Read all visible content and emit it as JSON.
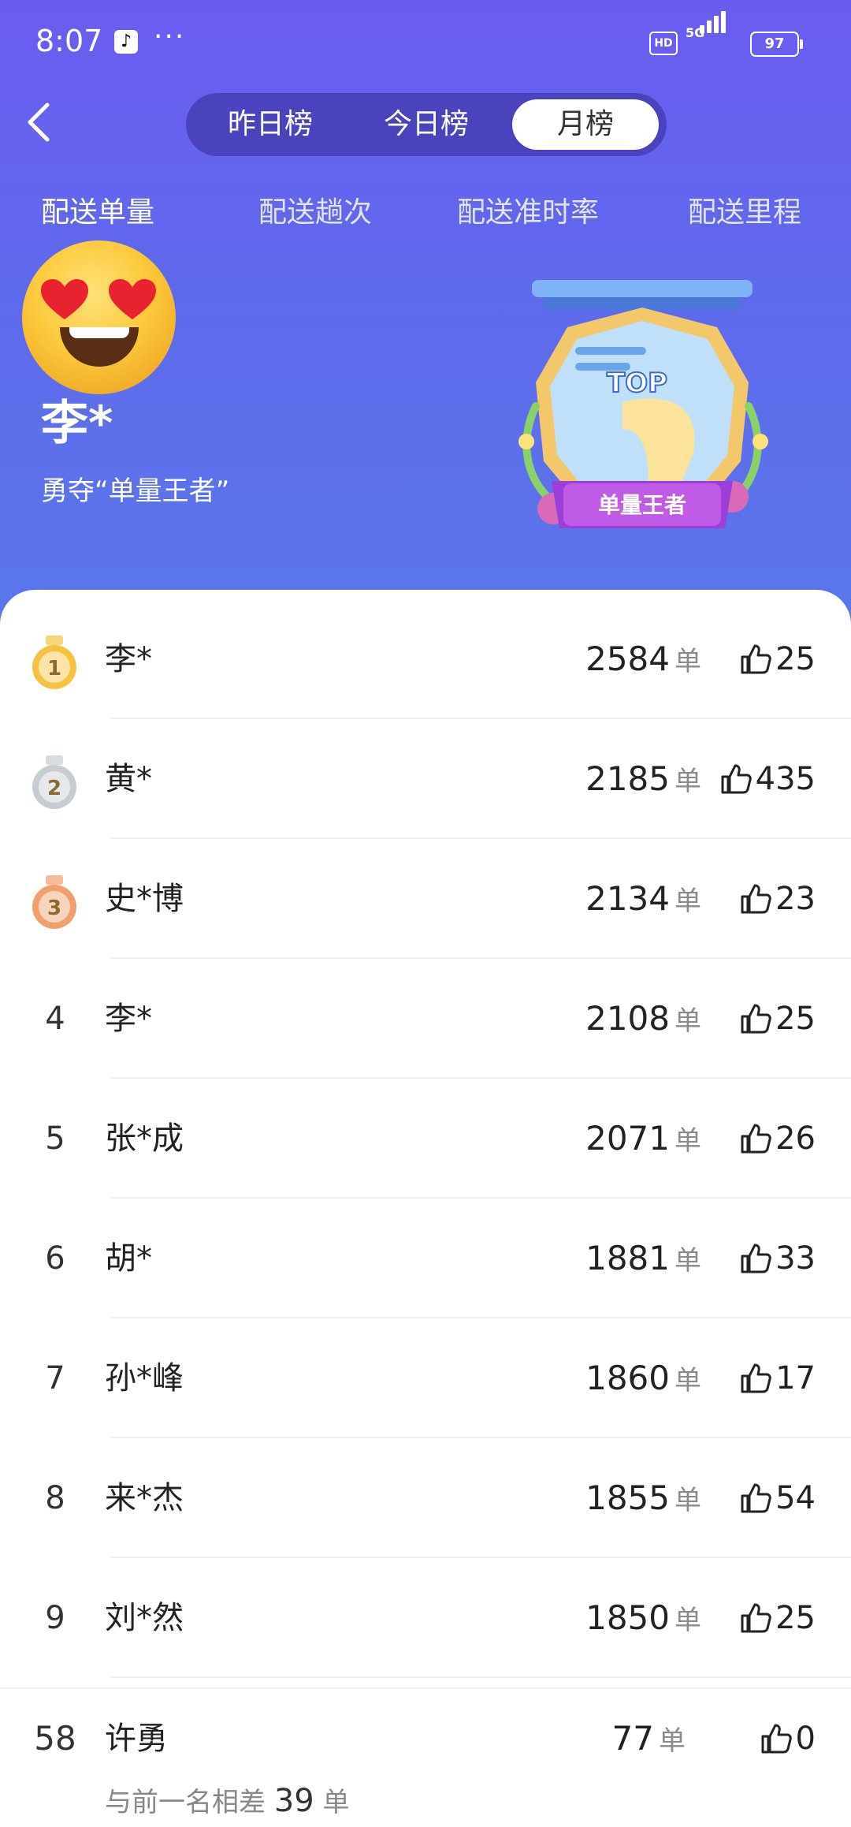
{
  "status_bar": {
    "time": "8:07",
    "tiktok_glyph": "♪",
    "more": "···",
    "hd": "HD",
    "network": "5G",
    "battery": "97"
  },
  "tabs": [
    "昨日榜",
    "今日榜",
    "月榜"
  ],
  "active_tab": "月榜",
  "categories": [
    "配送单量",
    "配送趟次",
    "配送准时率",
    "配送里程"
  ],
  "active_category": "配送单量",
  "leader": {
    "name": "李*",
    "title": "勇夺“单量王者”",
    "badge_top": "TOP",
    "badge_label": "单量王者"
  },
  "unit": "单",
  "ranking": [
    {
      "rank": "1",
      "name": "李*",
      "orders": "2584",
      "likes": "25",
      "medal": "gold"
    },
    {
      "rank": "2",
      "name": "黄*",
      "orders": "2185",
      "likes": "435",
      "medal": "silver"
    },
    {
      "rank": "3",
      "name": "史*博",
      "orders": "2134",
      "likes": "23",
      "medal": "bronze"
    },
    {
      "rank": "4",
      "name": "李*",
      "orders": "2108",
      "likes": "25"
    },
    {
      "rank": "5",
      "name": "张*成",
      "orders": "2071",
      "likes": "26"
    },
    {
      "rank": "6",
      "name": "胡*",
      "orders": "1881",
      "likes": "33"
    },
    {
      "rank": "7",
      "name": "孙*峰",
      "orders": "1860",
      "likes": "17"
    },
    {
      "rank": "8",
      "name": "来*杰",
      "orders": "1855",
      "likes": "54"
    },
    {
      "rank": "9",
      "name": "刘*然",
      "orders": "1850",
      "likes": "25"
    }
  ],
  "my_rank": {
    "rank": "58",
    "name": "许勇",
    "orders": "77",
    "likes": "0",
    "gap_prefix": "与前一名相差",
    "gap_value": "39",
    "gap_unit": "单"
  },
  "colors": {
    "header_top": "#6b5cf0",
    "header_bottom": "#5a78ea",
    "gold": "#f5c242",
    "silver": "#c7ccd3",
    "bronze": "#f0a06e"
  }
}
